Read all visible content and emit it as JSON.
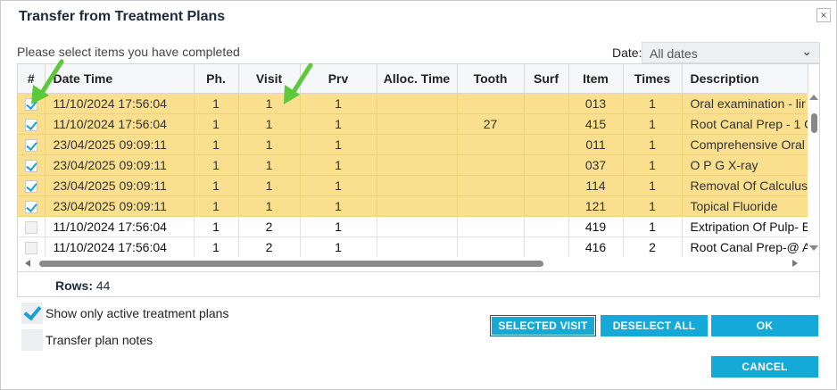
{
  "dialog": {
    "title": "Transfer from Treatment Plans",
    "close_glyph": "×",
    "subtitle": "Please select items you have completed",
    "date_label": "Date:",
    "date_value": "All dates"
  },
  "grid": {
    "columns": [
      "#",
      "Date Time",
      "Ph.",
      "Visit",
      "Prv",
      "Alloc. Time",
      "Tooth",
      "Surf",
      "Item",
      "Times",
      "Description"
    ],
    "rows": [
      {
        "checked": true,
        "datetime": "11/10/2024 17:56:04",
        "ph": "1",
        "visit": "1",
        "prv": "1",
        "alloc": "",
        "tooth": "",
        "surf": "",
        "item": "013",
        "times": "1",
        "description": "Oral examination - lir"
      },
      {
        "checked": true,
        "datetime": "11/10/2024 17:56:04",
        "ph": "1",
        "visit": "1",
        "prv": "1",
        "alloc": "",
        "tooth": "27",
        "surf": "",
        "item": "415",
        "times": "1",
        "description": "Root Canal Prep - 1 C"
      },
      {
        "checked": true,
        "datetime": "23/04/2025 09:09:11",
        "ph": "1",
        "visit": "1",
        "prv": "1",
        "alloc": "",
        "tooth": "",
        "surf": "",
        "item": "011",
        "times": "1",
        "description": "Comprehensive Oral"
      },
      {
        "checked": true,
        "datetime": "23/04/2025 09:09:11",
        "ph": "1",
        "visit": "1",
        "prv": "1",
        "alloc": "",
        "tooth": "",
        "surf": "",
        "item": "037",
        "times": "1",
        "description": "O P G X-ray"
      },
      {
        "checked": true,
        "datetime": "23/04/2025 09:09:11",
        "ph": "1",
        "visit": "1",
        "prv": "1",
        "alloc": "",
        "tooth": "",
        "surf": "",
        "item": "114",
        "times": "1",
        "description": "Removal Of Calculus"
      },
      {
        "checked": true,
        "datetime": "23/04/2025 09:09:11",
        "ph": "1",
        "visit": "1",
        "prv": "1",
        "alloc": "",
        "tooth": "",
        "surf": "",
        "item": "121",
        "times": "1",
        "description": "Topical Fluoride"
      },
      {
        "checked": false,
        "datetime": "11/10/2024 17:56:04",
        "ph": "1",
        "visit": "2",
        "prv": "1",
        "alloc": "",
        "tooth": "",
        "surf": "",
        "item": "419",
        "times": "1",
        "description": "Extripation Of Pulp- E"
      },
      {
        "checked": false,
        "datetime": "11/10/2024 17:56:04",
        "ph": "1",
        "visit": "2",
        "prv": "1",
        "alloc": "",
        "tooth": "",
        "surf": "",
        "item": "416",
        "times": "2",
        "description": "Root Canal Prep-@ A"
      }
    ],
    "rows_label": "Rows:",
    "rows_count": "44"
  },
  "options": {
    "show_active_label": "Show only active treatment plans",
    "show_active_checked": true,
    "transfer_notes_label": "Transfer plan notes",
    "transfer_notes_checked": false
  },
  "buttons": {
    "selected_visit": "SELECTED VISIT",
    "deselect_all": "DESELECT ALL",
    "ok": "OK",
    "cancel": "CANCEL"
  },
  "colors": {
    "accent": "#14a9d6",
    "selected_row": "#f9df8e",
    "annotation_arrow": "#5cc83a"
  },
  "icons": {
    "close": "close-icon",
    "dropdown": "chevron-down-icon",
    "annotation": "green-arrow-icon"
  }
}
